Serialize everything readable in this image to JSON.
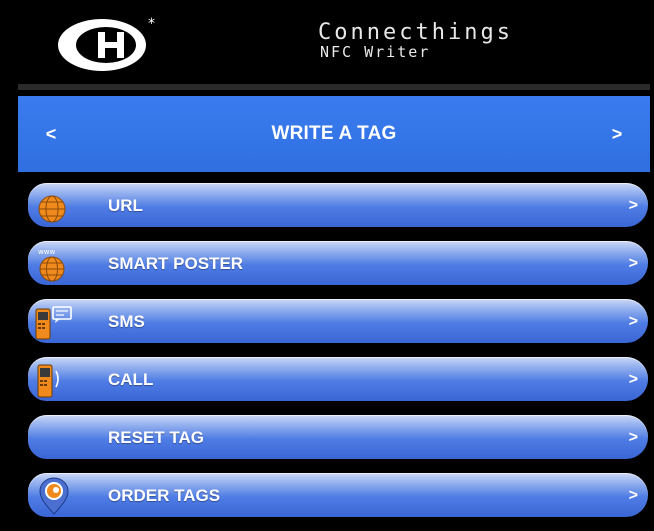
{
  "header": {
    "brand_line1": "Connecthings",
    "brand_line2": "NFC Writer"
  },
  "titlebar": {
    "prev_label": "<",
    "title": "WRITE A TAG",
    "next_label": ">"
  },
  "menu": {
    "items": [
      {
        "label": "URL",
        "icon": "globe-icon",
        "chevron": ">"
      },
      {
        "label": "SMART POSTER",
        "icon": "www-globe-icon",
        "chevron": ">"
      },
      {
        "label": "SMS",
        "icon": "phone-message-icon",
        "chevron": ">"
      },
      {
        "label": "CALL",
        "icon": "phone-call-icon",
        "chevron": ">"
      },
      {
        "label": "RESET TAG",
        "icon": "",
        "chevron": ">"
      },
      {
        "label": "ORDER TAGS",
        "icon": "location-pin-icon",
        "chevron": ">"
      }
    ]
  },
  "colors": {
    "background": "#000000",
    "accent": "#2f6fe0",
    "icon_orange": "#f08a1c"
  }
}
